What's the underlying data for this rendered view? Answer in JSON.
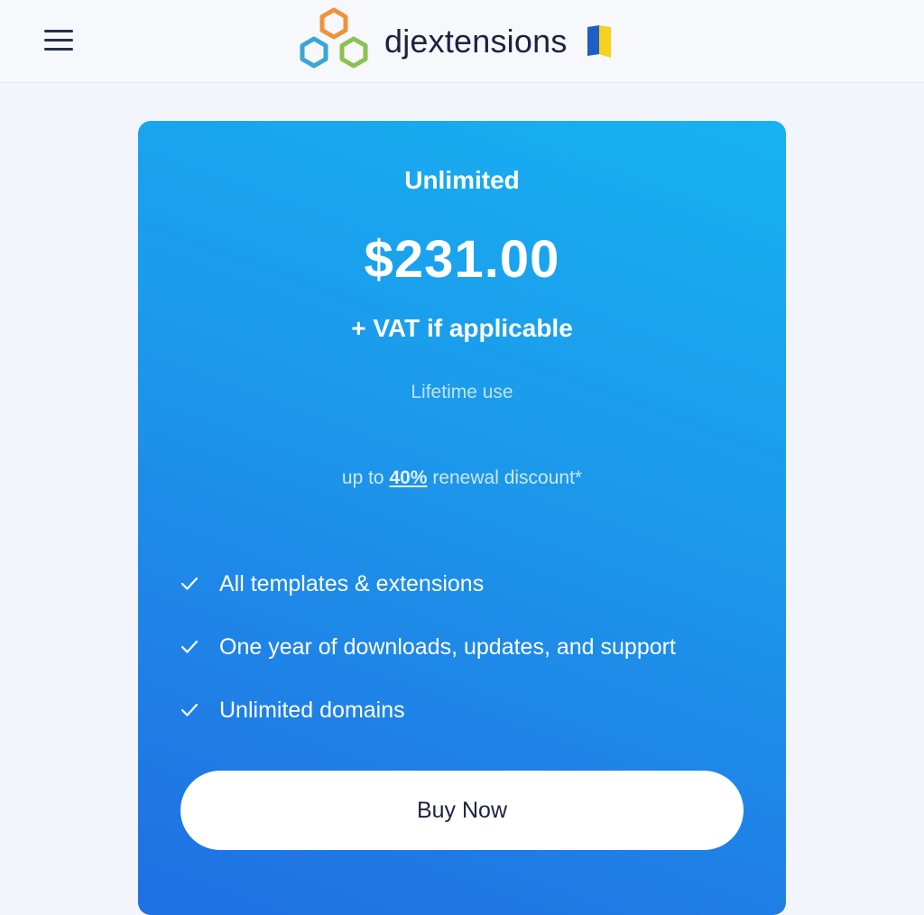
{
  "header": {
    "menu_icon": "hamburger-menu-icon",
    "logo_icon": "hexagon-logo-icon",
    "brand_name": "djextensions",
    "flag_icon": "ukraine-flag-icon",
    "colors": {
      "hex_orange": "#f0923c",
      "hex_blue": "#3aa6d8",
      "hex_green": "#8cc152",
      "flag_blue": "#1f5fc4",
      "flag_yellow": "#f7d11e"
    }
  },
  "plan": {
    "name": "Unlimited",
    "price": "$231.00",
    "vat_note": "+ VAT if applicable",
    "term": "Lifetime use",
    "renewal": {
      "prefix": "up to",
      "discount": "40%",
      "suffix": "renewal discount*"
    },
    "features": [
      {
        "icon": "checkmark-icon",
        "text": "All templates & extensions"
      },
      {
        "icon": "checkmark-icon",
        "text": "One year of downloads, updates, and support"
      },
      {
        "icon": "checkmark-icon",
        "text": "Unlimited domains"
      }
    ],
    "cta_label": "Buy Now",
    "colors": {
      "gradient_top": "#17b2f2",
      "gradient_bottom": "#1f6fe2"
    }
  }
}
